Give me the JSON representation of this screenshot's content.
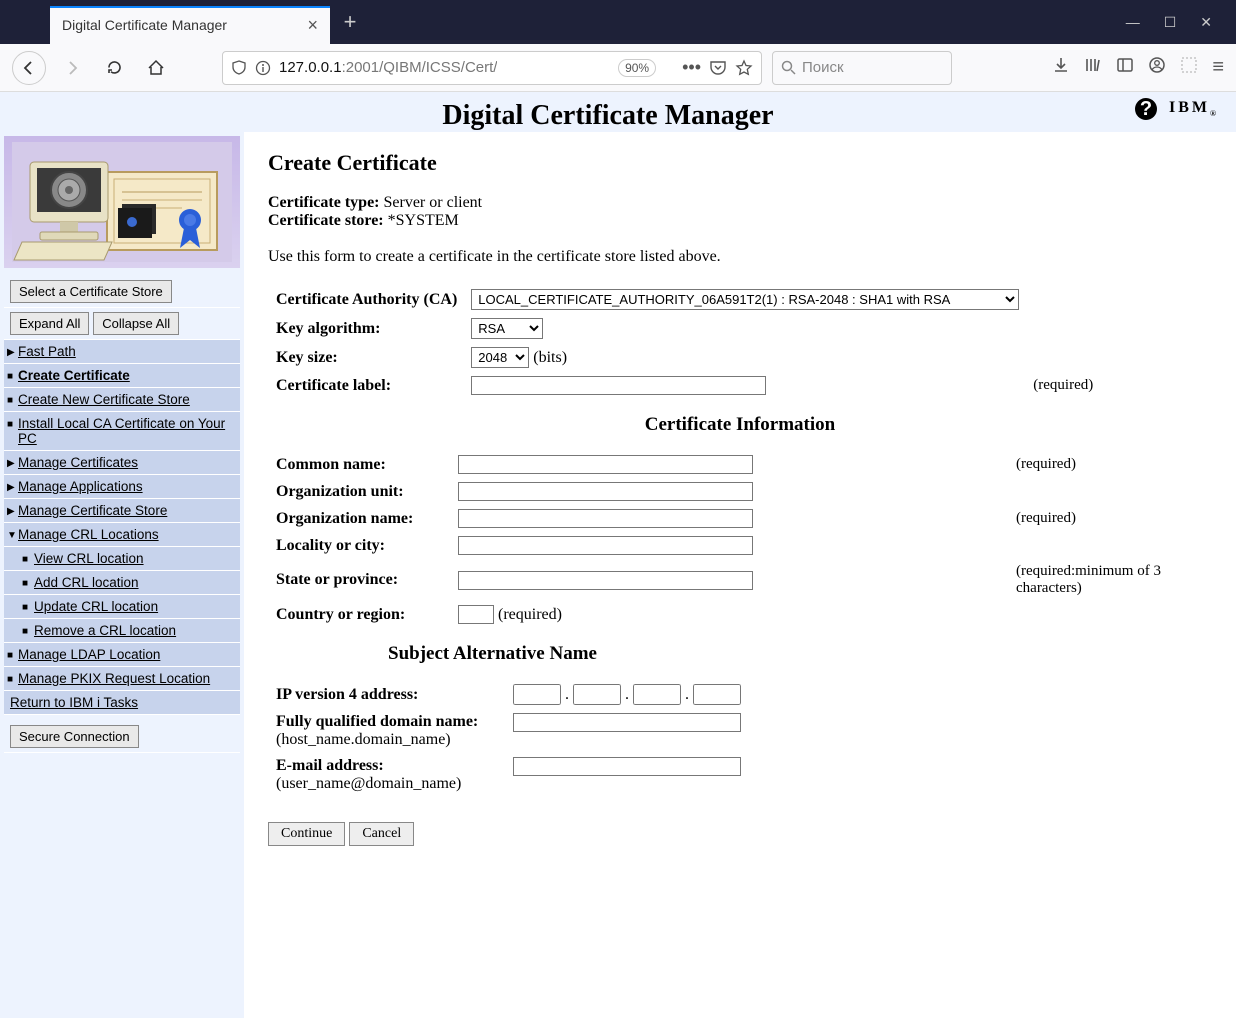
{
  "browser": {
    "tab_title": "Digital Certificate Manager",
    "url_prefix": "127.0.0.1",
    "url_suffix": ":2001/QIBM/ICSS/Cert/",
    "zoom": "90%",
    "search_placeholder": "Поиск"
  },
  "header": {
    "title": "Digital Certificate Manager",
    "brand": "IBM"
  },
  "sidebar": {
    "select_store": "Select a Certificate Store",
    "expand_all": "Expand All",
    "collapse_all": "Collapse All",
    "items": [
      {
        "label": "Fast Path",
        "kind": "arrow"
      },
      {
        "label": "Create Certificate",
        "kind": "square",
        "selected": true
      },
      {
        "label": "Create New Certificate Store",
        "kind": "square"
      },
      {
        "label": "Install Local CA Certificate on Your PC",
        "kind": "square"
      },
      {
        "label": "Manage Certificates",
        "kind": "arrow"
      },
      {
        "label": "Manage Applications",
        "kind": "arrow"
      },
      {
        "label": "Manage Certificate Store",
        "kind": "arrow"
      },
      {
        "label": "Manage CRL Locations",
        "kind": "down",
        "children": [
          {
            "label": "View CRL location"
          },
          {
            "label": "Add CRL location"
          },
          {
            "label": "Update CRL location"
          },
          {
            "label": "Remove a CRL location"
          }
        ]
      },
      {
        "label": "Manage LDAP Location",
        "kind": "square"
      },
      {
        "label": "Manage PKIX Request Location",
        "kind": "square"
      },
      {
        "label": "Return to IBM i Tasks",
        "kind": "plain"
      }
    ],
    "secure_btn": "Secure Connection"
  },
  "main": {
    "page_title": "Create Certificate",
    "cert_type_label": "Certificate type:",
    "cert_type_value": "Server or client",
    "cert_store_label": "Certificate store:",
    "cert_store_value": "*SYSTEM",
    "instructions": "Use this form to create a certificate in the certificate store listed above.",
    "ca_label": "Certificate Authority (CA)",
    "ca_value": "LOCAL_CERTIFICATE_AUTHORITY_06A591T2(1) : RSA-2048 : SHA1 with RSA",
    "keyalg_label": "Key algorithm:",
    "keyalg_value": "RSA",
    "keysize_label": "Key size:",
    "keysize_value": "2048",
    "keysize_unit": "(bits)",
    "certlabel_label": "Certificate label:",
    "required": "(required)",
    "section_certinfo": "Certificate Information",
    "cn_label": "Common name:",
    "ou_label": "Organization unit:",
    "on_label": "Organization name:",
    "loc_label": "Locality or city:",
    "state_label": "State or province:",
    "state_req": "(required:minimum of 3 characters)",
    "country_label": "Country or region:",
    "section_san": "Subject Alternative Name",
    "ip_label": "IP version 4 address:",
    "fqdn_label": "Fully qualified domain name:",
    "fqdn_hint": "(host_name.domain_name)",
    "email_label": "E-mail address:",
    "email_hint": "(user_name@domain_name)",
    "continue_btn": "Continue",
    "cancel_btn": "Cancel"
  }
}
